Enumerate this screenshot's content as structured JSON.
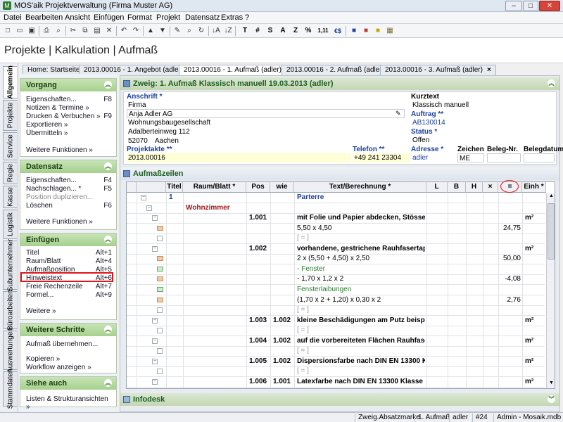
{
  "window": {
    "title": "MOS'aik Projektverwaltung (Firma Muster AG)",
    "minimize": "–",
    "maximize": "□",
    "close": "✕"
  },
  "menu": [
    "Datei",
    "Bearbeiten",
    "Ansicht",
    "Einfügen",
    "Format",
    "Projekt",
    "Datensatz",
    "Extras",
    "?"
  ],
  "toolbar": {
    "text_buttons": [
      "T",
      "#",
      "S",
      "A",
      "Z",
      "%",
      "1,11",
      "€$"
    ]
  },
  "header": {
    "title": "Projekte | Kalkulation | Aufmaß"
  },
  "vertical_tabs": [
    "Allgemein",
    "Projekte",
    "Service",
    "Regie",
    "Kasse",
    "Logistik",
    "Subunternehmer",
    "Büroarbeiten",
    "Auswertungen",
    "Stammdaten"
  ],
  "doc_tabs": [
    {
      "label": "Home: Startseite",
      "closable": false
    },
    {
      "label": "2013.00016 - 1. Angebot (adler)",
      "closable": false
    },
    {
      "label": "2013.00016 - 1. Aufmaß (adler)",
      "closable": true
    },
    {
      "label": "2013.00016 - 2. Aufmaß (adler)",
      "closable": true
    },
    {
      "label": "2013.00016 - 3. Aufmaß (adler)",
      "closable": true
    }
  ],
  "sidebar": {
    "vorgang": {
      "title": "Vorgang",
      "items": [
        {
          "label": "Eigenschaften...",
          "key": "F8"
        },
        {
          "label": "Notizen & Termine »",
          "key": ""
        },
        {
          "label": "Drucken & Verbuchen »",
          "key": "F9"
        },
        {
          "label": "Exportieren »",
          "key": ""
        },
        {
          "label": "Übermitteln »",
          "key": ""
        }
      ],
      "more": "Weitere Funktionen »"
    },
    "datensatz": {
      "title": "Datensatz",
      "items": [
        {
          "label": "Eigenschaften...",
          "key": "F4"
        },
        {
          "label": "Nachschlagen... *",
          "key": "F5"
        },
        {
          "label": "Position duplizieren...",
          "key": "",
          "disabled": true
        },
        {
          "label": "Löschen",
          "key": "F6"
        }
      ],
      "more": "Weitere Funktionen »"
    },
    "einfuegen": {
      "title": "Einfügen",
      "items": [
        {
          "label": "Titel",
          "key": "Alt+1"
        },
        {
          "label": "Raum/Blatt",
          "key": "Alt+4"
        },
        {
          "label": "Aufmaßposition",
          "key": "Alt+5"
        },
        {
          "label": "Hinweistext",
          "key": "Alt+6"
        },
        {
          "label": "Freie Rechenzeile",
          "key": "Alt+7"
        },
        {
          "label": "Formel...",
          "key": "Alt+9"
        }
      ],
      "more": "Weitere »"
    },
    "schritte": {
      "title": "Weitere Schritte",
      "items": [
        {
          "label": "Aufmaß übernehmen..."
        },
        {
          "label": "Kopieren »"
        },
        {
          "label": "Workflow anzeigen »"
        }
      ]
    },
    "siehe": {
      "title": "Siehe auch",
      "items": [
        {
          "label": "Listen & Strukturansichten »"
        }
      ]
    }
  },
  "zweig": {
    "title": "Zweig: 1. Aufmaß Klassisch manuell 19.03.2013 (adler)",
    "anschrift_label": "Anschrift *",
    "anschrift": [
      "Firma",
      "Anja Adler AG",
      "Wohnungsbaugesellschaft",
      "Adalberteinweg 112",
      "52070",
      "Aachen"
    ],
    "kurztext_label": "Kurztext",
    "kurztext": "Klassisch manuell",
    "auftrag_label": "Auftrag **",
    "auftrag": "AB130014",
    "status_label": "Status *",
    "status": "Offen",
    "projektakte_label": "Projektakte **",
    "projektakte": "2013.00016",
    "telefon_label": "Telefon **",
    "telefon": "+49 241 23304",
    "adresse_label": "Adresse *",
    "adresse": "adler",
    "zeichen_label": "Zeichen",
    "zeichen": "ME",
    "belegnr_label": "Beleg-Nr.",
    "belegdatum_label": "Belegdatum"
  },
  "aufmass": {
    "title": "Aufmaßzeilen",
    "columns": [
      "Titel",
      "Raum/Blatt *",
      "Pos",
      "wie",
      "Text/Berechnung *",
      "L",
      "B",
      "H",
      "×",
      "=",
      "Einh *"
    ],
    "rows": [
      {
        "titel": "1",
        "text": "Parterre",
        "style": "blue"
      },
      {
        "raum": "Wohnzimmer",
        "style": "red"
      },
      {
        "pos": "1.001",
        "text": "mit Folie und Papier abdecken, Stösse d...",
        "einh": "m²",
        "bold": true
      },
      {
        "text": "5,50 x 4,50",
        "result": "24,75"
      },
      {
        "text": "[ = ]",
        "style": "gray"
      },
      {
        "pos": "1.002",
        "text": "vorhandene, gestrichene Rauhfasertape...",
        "einh": "m²",
        "bold": true
      },
      {
        "text": "2 x (5,50 + 4,50) x 2,50",
        "result": "50,00"
      },
      {
        "text": "- Fenster",
        "style": "green"
      },
      {
        "text": "- 1,70 x 1,2 x 2",
        "result": "-4,08"
      },
      {
        "text": "Fensterlaibungen",
        "style": "green"
      },
      {
        "text": "(1,70 x 2 + 1,20) x 0,30 x 2",
        "result": "2,76"
      },
      {
        "text": "[ = ]",
        "style": "gray"
      },
      {
        "pos": "1.003",
        "wie": "1.002",
        "text": "kleine Beschädigungen am Putz beispac...",
        "einh": "m²",
        "bold": true
      },
      {
        "text": "[ = ]",
        "style": "gray"
      },
      {
        "pos": "1.004",
        "wie": "1.002",
        "text": "auf die vorbereiteten Flächen Rauhfaser...",
        "einh": "m²",
        "bold": true
      },
      {
        "text": "[ = ]",
        "style": "gray"
      },
      {
        "pos": "1.005",
        "wie": "1.002",
        "text": "Dispersionsfarbe nach DIN EN 13300 Klas...",
        "einh": "m²",
        "bold": true
      },
      {
        "text": "[ = ]",
        "style": "gray"
      },
      {
        "pos": "1.006",
        "wie": "1.001",
        "text": "Latexfarbe nach DIN EN 13300 Klasse 2, ...",
        "einh": "m²",
        "bold": true
      }
    ]
  },
  "infodesk": {
    "title": "Infodesk"
  },
  "status": [
    "Zweig.Absatzmarke",
    "1. Aufmaß",
    "adler",
    "#24",
    "Admin - Mosaik.mdb"
  ],
  "colors": {
    "panel_header": "#a6d08e",
    "highlight": "#e0161d",
    "link_blue": "#1a3fa0"
  }
}
